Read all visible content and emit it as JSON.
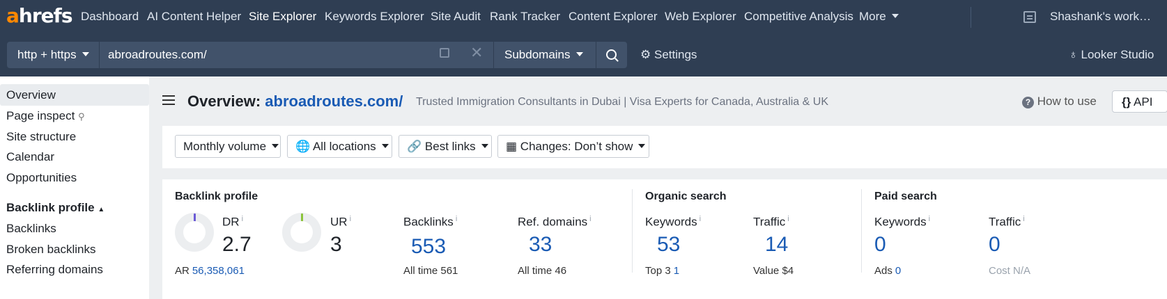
{
  "nav": {
    "logo_a": "a",
    "logo_rest": "hrefs",
    "items": [
      "Dashboard",
      "AI Content Helper",
      "Site Explorer",
      "Keywords Explorer",
      "Site Audit",
      "Rank Tracker",
      "Content Explorer",
      "Web Explorer",
      "Competitive Analysis",
      "More"
    ],
    "active": "Site Explorer",
    "workspace": "Shashank's work…"
  },
  "toolbar": {
    "protocol": "http + https",
    "url": "abroadroutes.com/",
    "mode": "Subdomains",
    "settings": "Settings",
    "looker": "Looker Studio"
  },
  "sidebar": {
    "items": [
      "Overview",
      "Page inspect",
      "Site structure",
      "Calendar",
      "Opportunities"
    ],
    "section": "Backlink profile",
    "section_items": [
      "Backlinks",
      "Broken backlinks",
      "Referring domains"
    ]
  },
  "header": {
    "title_prefix": "Overview:",
    "title_domain": "abroadroutes.com/",
    "subtitle": "Trusted Immigration Consultants in Dubai | Visa Experts for Canada, Australia & UK",
    "how_to_use": "How to use",
    "api": "API"
  },
  "filters": {
    "volume": "Monthly volume",
    "locations": "All locations",
    "links": "Best links",
    "changes": "Changes: Don’t show"
  },
  "backlink_profile": {
    "heading": "Backlink profile",
    "dr_label": "DR",
    "dr_value": "2.7",
    "dr_gauge_color": "#6b5bd6",
    "ar_label": "AR",
    "ar_value": "56,358,061",
    "ur_label": "UR",
    "ur_value": "3",
    "ur_gauge_color": "#8cc43b",
    "backlinks_label": "Backlinks",
    "backlinks_value": "553",
    "backlinks_alltime_label": "All time",
    "backlinks_alltime": "561",
    "refdomains_label": "Ref. domains",
    "refdomains_value": "33",
    "refdomains_alltime_label": "All time",
    "refdomains_alltime": "46"
  },
  "organic": {
    "heading": "Organic search",
    "keywords_label": "Keywords",
    "keywords_value": "53",
    "top3_label": "Top 3",
    "top3_value": "1",
    "traffic_label": "Traffic",
    "traffic_value": "14",
    "value_label": "Value",
    "value_value": "$4"
  },
  "paid": {
    "heading": "Paid search",
    "keywords_label": "Keywords",
    "keywords_value": "0",
    "ads_label": "Ads",
    "ads_value": "0",
    "traffic_label": "Traffic",
    "traffic_value": "0",
    "cost_label": "Cost",
    "cost_value": "N/A"
  },
  "info_marker": "i"
}
